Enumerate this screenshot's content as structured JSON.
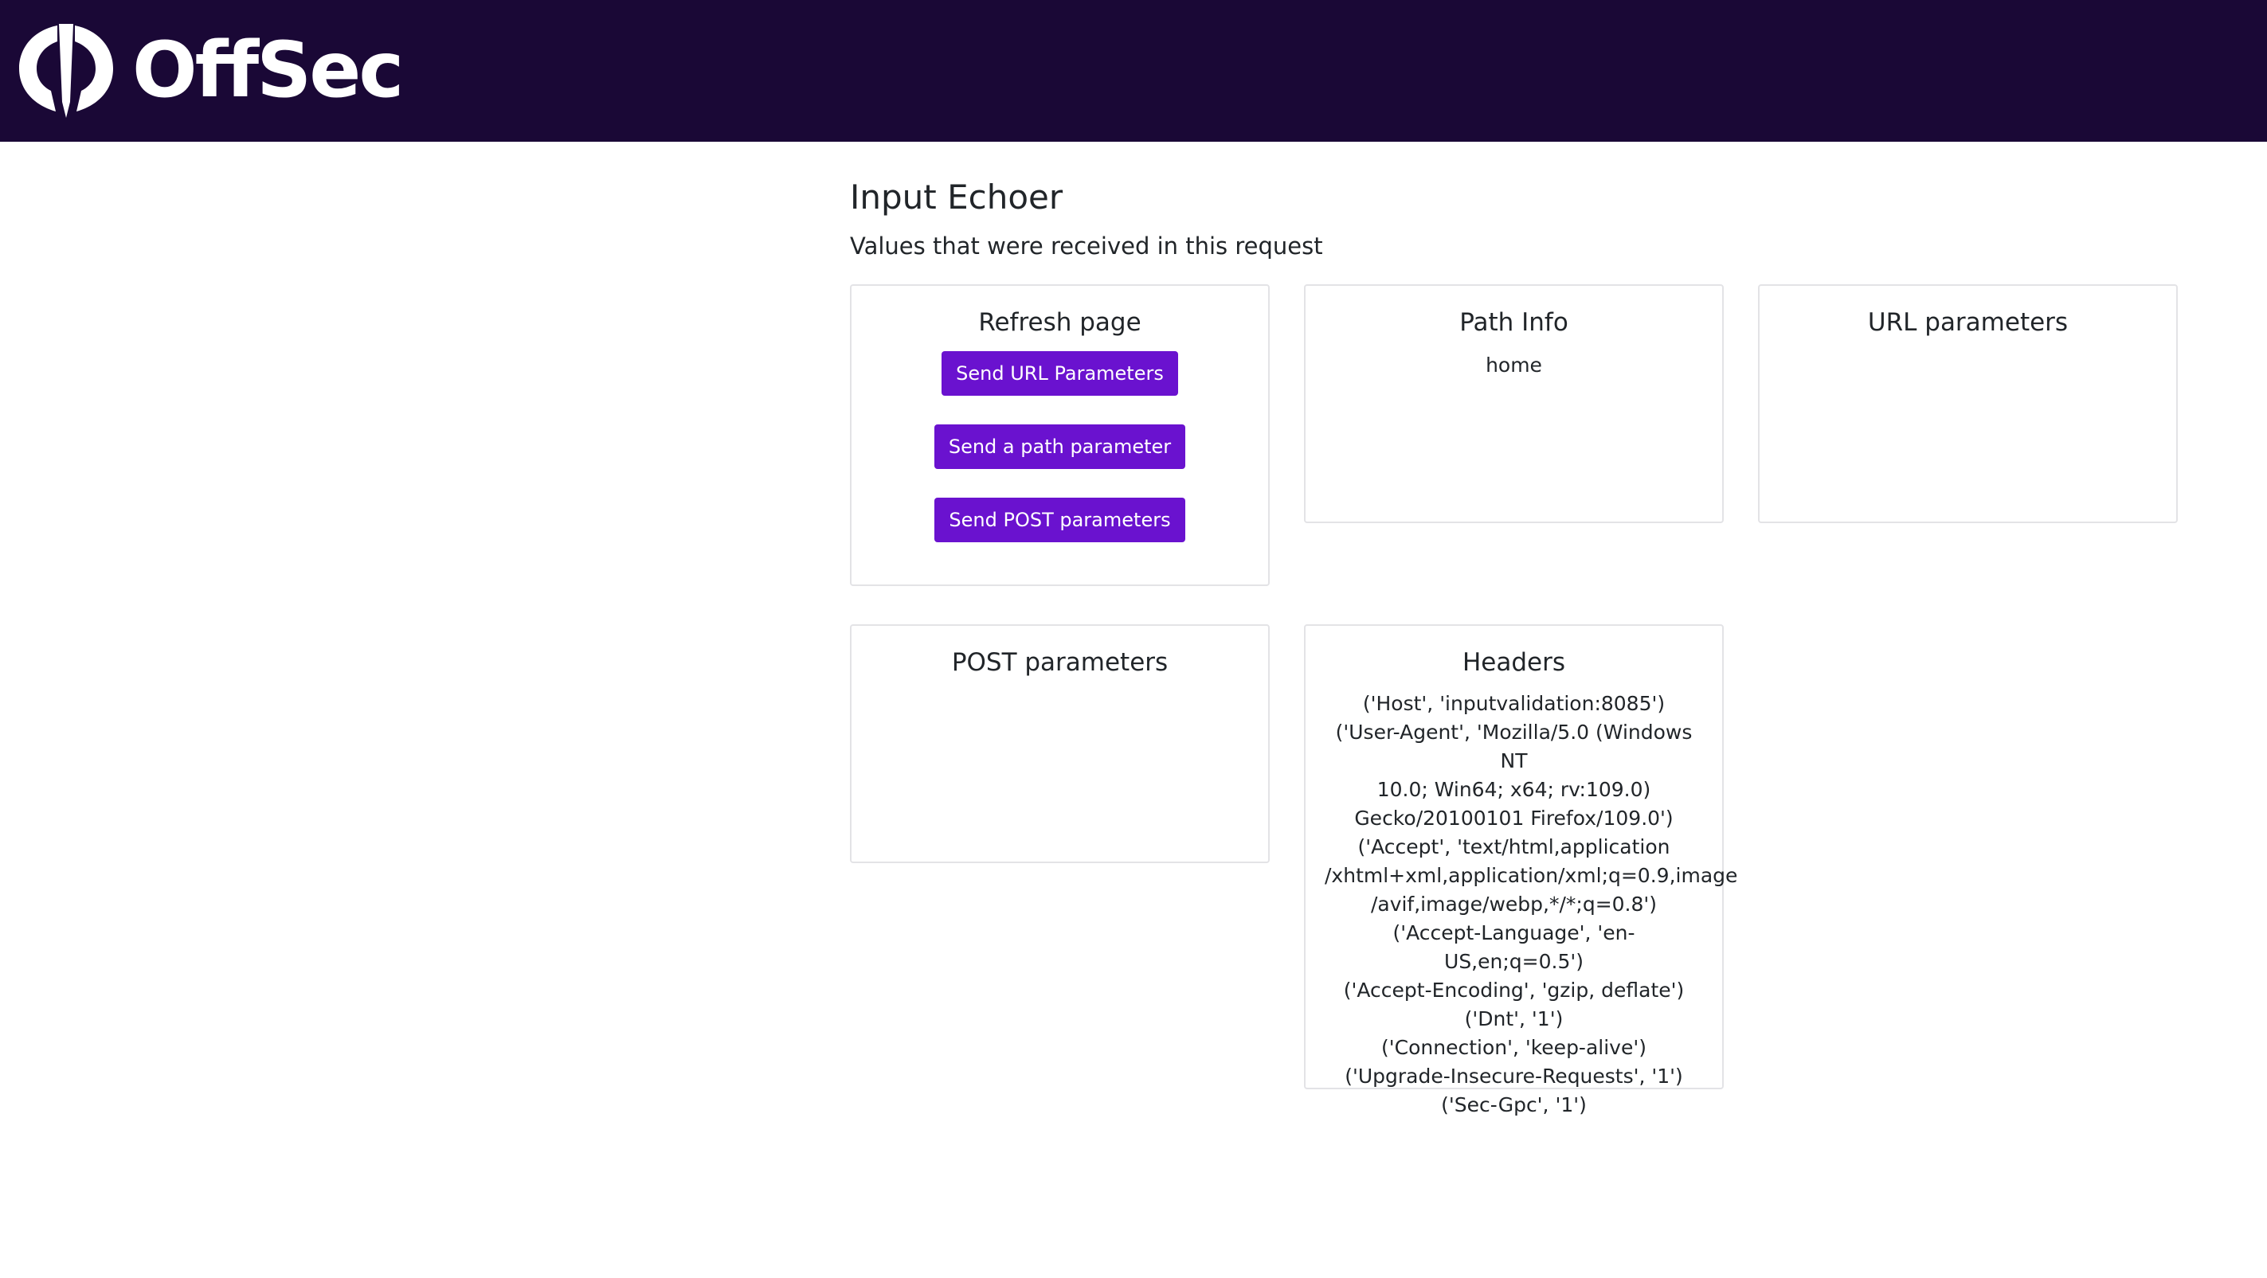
{
  "brand": {
    "name": "OffSec",
    "colors": {
      "topbar": "#1a0836",
      "button": "#6a12cf"
    }
  },
  "page": {
    "title": "Input Echoer",
    "subtitle": "Values that were received in this request"
  },
  "cards": {
    "refresh": {
      "title": "Refresh page",
      "buttons": {
        "url": "Send URL Parameters",
        "path": "Send a path parameter",
        "post": "Send POST parameters"
      }
    },
    "path_info": {
      "title": "Path Info",
      "value": "home"
    },
    "url_params": {
      "title": "URL parameters"
    },
    "post_params": {
      "title": "POST parameters"
    },
    "headers": {
      "title": "Headers",
      "lines": [
        "('Host', 'inputvalidation:8085')",
        "('User-Agent', 'Mozilla/5.0 (Windows NT",
        "10.0; Win64; x64; rv:109.0)",
        "Gecko/20100101 Firefox/109.0')",
        "('Accept', 'text/html,application",
        "/xhtml+xml,application/xml;q=0.9,image",
        "/avif,image/webp,*/*;q=0.8')",
        "('Accept-Language', 'en-US,en;q=0.5')",
        "('Accept-Encoding', 'gzip, deflate')",
        "('Dnt', '1')",
        "('Connection', 'keep-alive')",
        "('Upgrade-Insecure-Requests', '1')",
        "('Sec-Gpc', '1')"
      ]
    }
  }
}
